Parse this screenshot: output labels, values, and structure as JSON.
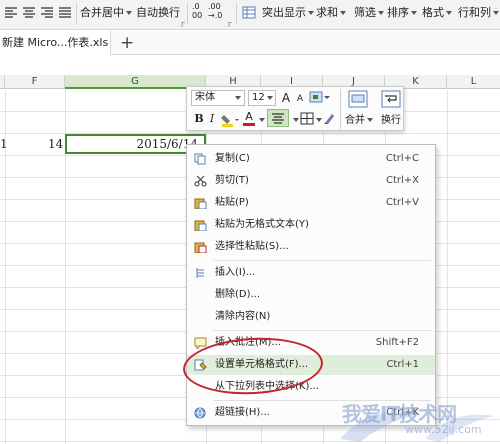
{
  "ribbon": {
    "merge_center_label": "合并居中",
    "wrap_text_label": "自动换行",
    "decimal_increase_label": ".0",
    "decimal_increase_label2": "00",
    "decimal_decrease_label": ".00",
    "decimal_decrease_label2": "→.0",
    "highlight_label": "突出显示",
    "sum_label": "求和",
    "filter_label": "筛选",
    "sort_label": "排序",
    "format_label": "格式",
    "rows_cols_label": "行和列",
    "group_marker": "Γ"
  },
  "tabs": {
    "file_tab_label": "新建 Micro...作表.xls *",
    "add_tab_label": "+"
  },
  "columns": [
    "F",
    "G",
    "H",
    "I",
    "J",
    "K",
    "L"
  ],
  "cells": {
    "e_value": "1",
    "f_value": "14",
    "g_value": "2015/6/14"
  },
  "minibar": {
    "font_name": "宋体",
    "font_size": "12",
    "grow_font": "A",
    "shrink_font": "A",
    "bold": "B",
    "italic": "I",
    "font_color": "A",
    "merge_label": "合并",
    "wrap_label": "换行"
  },
  "context_menu": {
    "items": [
      {
        "label": "复制(C)",
        "shortcut": "Ctrl+C"
      },
      {
        "label": "剪切(T)",
        "shortcut": "Ctrl+X"
      },
      {
        "label": "粘贴(P)",
        "shortcut": "Ctrl+V"
      },
      {
        "label": "粘贴为无格式文本(Y)",
        "shortcut": ""
      },
      {
        "label": "选择性粘贴(S)...",
        "shortcut": ""
      },
      {
        "label": "插入(I)...",
        "shortcut": ""
      },
      {
        "label": "删除(D)...",
        "shortcut": ""
      },
      {
        "label": "清除内容(N)",
        "shortcut": ""
      },
      {
        "label": "插入批注(M)...",
        "shortcut": "Shift+F2"
      },
      {
        "label": "设置单元格格式(F)...",
        "shortcut": "Ctrl+1"
      },
      {
        "label": "从下拉列表中选择(K)...",
        "shortcut": ""
      },
      {
        "label": "超链接(H)...",
        "shortcut": "Ctrl+K"
      }
    ]
  },
  "watermark": {
    "text": "我爱IT技术网",
    "url": "www.52ij.com"
  },
  "colors": {
    "accent_green": "#3d8b2d",
    "highlight_row": "#dfeeda",
    "annotation_red": "#c0262a"
  }
}
